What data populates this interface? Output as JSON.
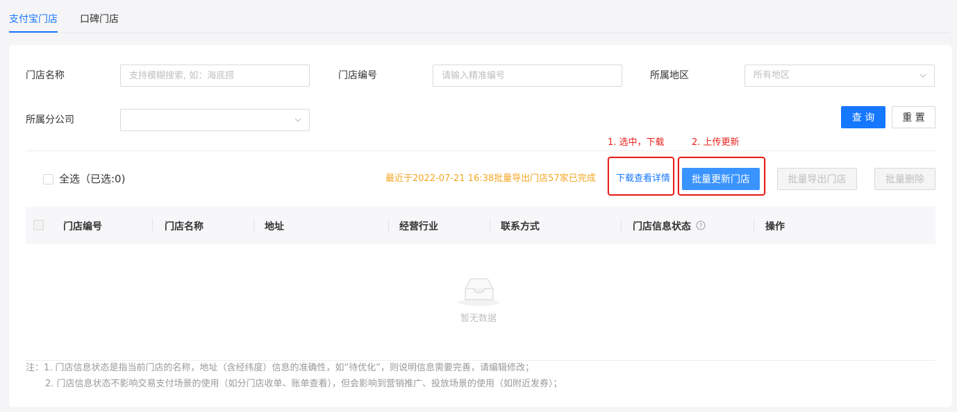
{
  "tabs": [
    {
      "label": "支付宝门店",
      "active": true
    },
    {
      "label": "口碑门店",
      "active": false
    }
  ],
  "filters": {
    "store_name_label": "门店名称",
    "store_name_placeholder": "支持模糊搜索, 如：海底捞",
    "store_no_label": "门店编号",
    "store_no_placeholder": "请输入精准编号",
    "region_label": "所属地区",
    "region_placeholder": "所有地区",
    "branch_label": "所属分公司",
    "branch_value": ""
  },
  "actions": {
    "query": "查 询",
    "reset": "重 置"
  },
  "toolbar": {
    "select_all": "全选（已选:0)",
    "export_status": "最近于2022-07-21 16:38批量导出门店57家已完成",
    "download_link": "下载查看详情",
    "batch_update": "批量更新门店",
    "batch_export": "批量导出门店",
    "batch_delete": "批量删除"
  },
  "annotations": {
    "step1": "1. 选中，下载",
    "step2": "2. 上传更新"
  },
  "table": {
    "columns": [
      "门店编号",
      "门店名称",
      "地址",
      "经营行业",
      "联系方式",
      "门店信息状态",
      "操作"
    ],
    "empty_text": "暂无数据"
  },
  "notes": {
    "line1": "注：1. 门店信息状态是指当前门店的名称，地址（含经纬度）信息的准确性，如“待优化”，则说明信息需要完善，请编辑修改；",
    "line2": "2. 门店信息状态不影响交易支付场景的使用（如分门店收单、账单查看），但会影响到营销推广、投放场景的使用（如附近发券）；"
  },
  "colors": {
    "primary": "#1677ff",
    "warning": "#f5a623",
    "annotation_red": "#e8201b"
  }
}
